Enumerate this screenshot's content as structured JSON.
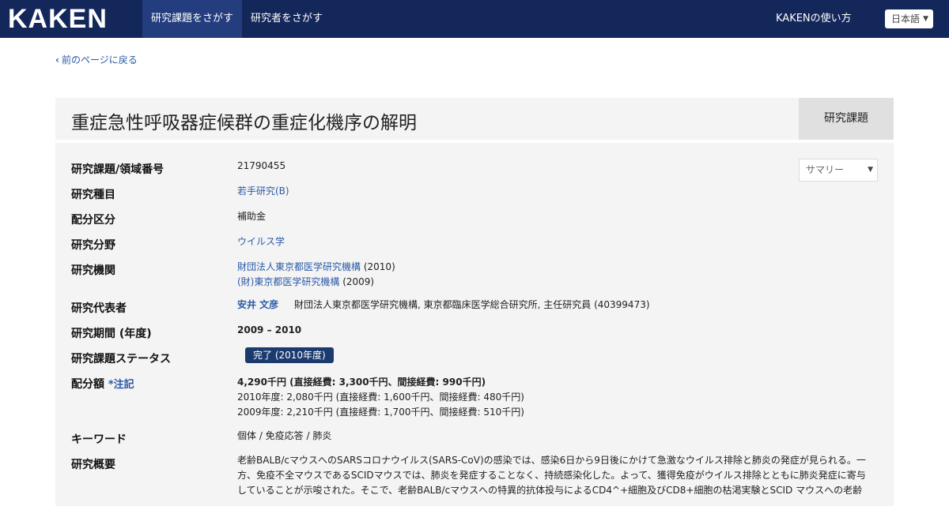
{
  "header": {
    "logo": "KAKEN",
    "tabs": [
      {
        "label": "研究課題をさがす",
        "active": true
      },
      {
        "label": "研究者をさがす",
        "active": false
      }
    ],
    "help_link": "KAKENの使い方",
    "language": "日本語"
  },
  "back_link": "前のページに戻る",
  "title": "重症急性呼吸器症候群の重症化機序の解明",
  "type_badge": "研究課題",
  "view_select": "サマリー",
  "rows": {
    "number": {
      "label": "研究課題/領域番号",
      "value": "21790455"
    },
    "category": {
      "label": "研究種目",
      "value": "若手研究(B)"
    },
    "allocation": {
      "label": "配分区分",
      "value": "補助金"
    },
    "field": {
      "label": "研究分野",
      "value": "ウイルス学"
    },
    "institution": {
      "label": "研究機関",
      "entries": [
        {
          "name": "財団法人東京都医学研究機構",
          "year": "(2010)"
        },
        {
          "name": "(財)東京都医学研究機構",
          "year": "(2009)"
        }
      ]
    },
    "pi": {
      "label": "研究代表者",
      "name": "安井 文彦",
      "affiliation": "財団法人東京都医学研究機構, 東京都臨床医学総合研究所, 主任研究員 (40399473)"
    },
    "period": {
      "label": "研究期間 (年度)",
      "value": "2009 – 2010"
    },
    "status": {
      "label": "研究課題ステータス",
      "value": "完了 (2010年度)"
    },
    "budget": {
      "label": "配分額",
      "note": "*注記",
      "total": "4,290千円 (直接経費: 3,300千円、間接経費: 990千円)",
      "years": [
        "2010年度: 2,080千円 (直接経費: 1,600千円、間接経費: 480千円)",
        "2009年度: 2,210千円 (直接経費: 1,700千円、間接経費: 510千円)"
      ]
    },
    "keywords": {
      "label": "キーワード",
      "value": "個体 / 免疫応答 / 肺炎"
    },
    "summary": {
      "label": "研究概要",
      "text": "老齢BALB/cマウスへのSARSコロナウイルス(SARS-CoV)の感染では、感染6日から9日後にかけて急激なウイルス排除と肺炎の発症が見られる。一方、免疫不全マウスであるSCIDマウスでは、肺炎を発症することなく、持続感染化した。よって、獲得免疫がウイルス排除とともに肺炎発症に寄与していることが示唆された。そこで、老齢BALB/cマウスへの特異的抗体投与によるCD4^+細胞及びCD8+細胞の枯渇実験とSCID マウスへの老齢"
    }
  },
  "colors": {
    "header_bg": "#14275a",
    "active_tab_bg": "#233d7e",
    "link": "#2a5aa8",
    "status_badge": "#1b3a6e"
  },
  "icons": {
    "back": "chevron-left-icon",
    "language_caret": "caret-down-icon",
    "view_caret": "caret-down-icon"
  }
}
